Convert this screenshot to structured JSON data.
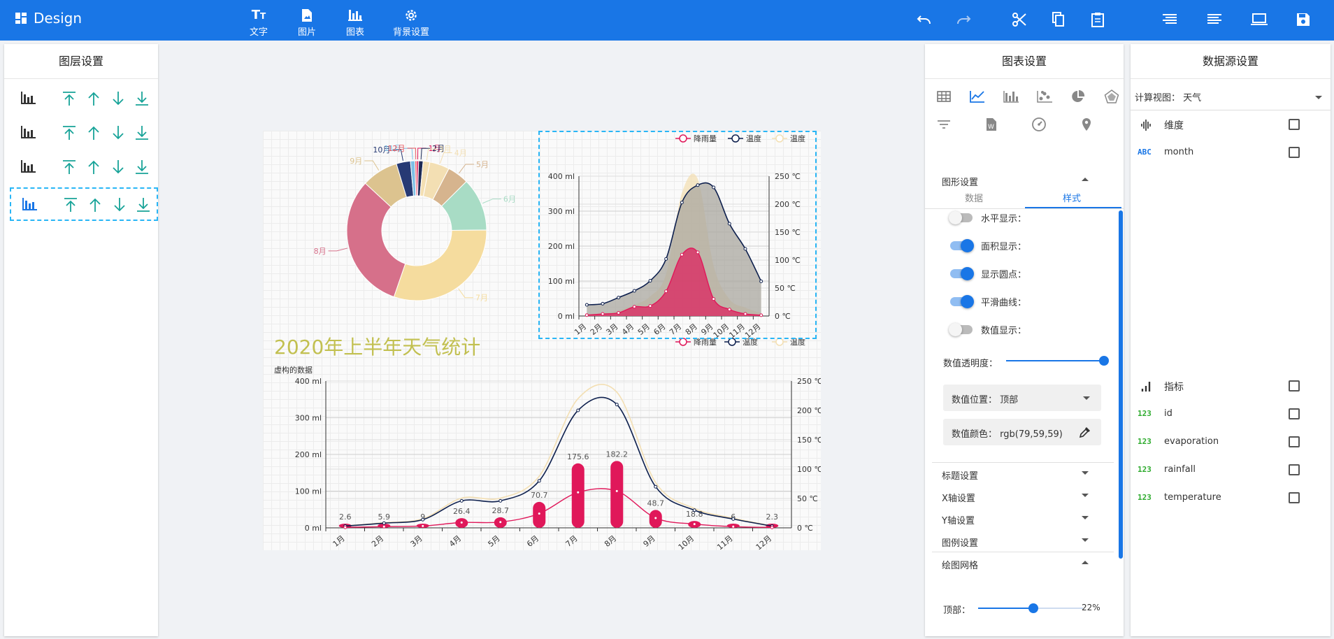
{
  "app": {
    "title": "Design"
  },
  "toolbar": {
    "items": [
      {
        "label": "文字",
        "icon": "text-icon"
      },
      {
        "label": "图片",
        "icon": "image-icon"
      },
      {
        "label": "图表",
        "icon": "chart-icon"
      },
      {
        "label": "背景设置",
        "icon": "gear-icon"
      }
    ]
  },
  "layer_panel": {
    "title": "图层设置"
  },
  "chart_settings": {
    "title": "图表设置",
    "tabs": [
      "数据",
      "样式"
    ],
    "active_tab": "样式",
    "sections": {
      "shape": "图形设置",
      "title": "标题设置",
      "xaxis": "X轴设置",
      "yaxis": "Y轴设置",
      "legend": "图例设置",
      "grid": "绘图网格"
    },
    "switches": [
      {
        "label": "水平显示：",
        "on": false
      },
      {
        "label": "面积显示：",
        "on": true
      },
      {
        "label": "显示圆点：",
        "on": true
      },
      {
        "label": "平滑曲线：",
        "on": true
      },
      {
        "label": "数值显示：",
        "on": false
      }
    ],
    "opacity_label": "数值透明度：",
    "opacity_value": 1.0,
    "value_position_label": "数值位置：",
    "value_position": "顶部",
    "value_color_label": "数值颜色：",
    "value_color": "rgb(79,59,59)",
    "top_label": "顶部：",
    "top_value": "22%",
    "top_fraction": 0.22
  },
  "data_source": {
    "title": "数据源设置",
    "view_label": "计算视图：",
    "view_value": "天气",
    "dimension_label": "维度",
    "dimensions": [
      {
        "badge": "ABC",
        "name": "month"
      }
    ],
    "measure_label": "指标",
    "measures": [
      {
        "badge": "123",
        "name": "id"
      },
      {
        "badge": "123",
        "name": "evaporation"
      },
      {
        "badge": "123",
        "name": "rainfall"
      },
      {
        "badge": "123",
        "name": "temperature"
      }
    ]
  },
  "colors": {
    "primary": "#1976e6",
    "rain": "#e0185a",
    "temp": "#0d1f4d",
    "temp2": "#f3dfb3",
    "title_green": "#c2c050",
    "selection": "#29b6f6"
  },
  "canvas": {
    "title": "2020年上半年天气统计"
  },
  "chart_data": [
    {
      "type": "pie",
      "variant": "donut",
      "categories": [
        "1月",
        "2月",
        "3月",
        "4月",
        "5月",
        "6月",
        "7月",
        "8月",
        "9月",
        "10月",
        "11月",
        "12月"
      ],
      "values": [
        2.6,
        5.9,
        9.0,
        26.4,
        28.7,
        70.7,
        175.6,
        182.2,
        48.7,
        18.8,
        6.0,
        2.3
      ],
      "colors": [
        "#e0185a",
        "#1c2a55",
        "#f3dfb3",
        "#f3dfb3",
        "#d6b48e",
        "#a8dcc5",
        "#f5dc9e",
        "#d6708a",
        "#dcc38f",
        "#273a74",
        "#7ec0e6",
        "#e9545b"
      ]
    },
    {
      "type": "area",
      "categories": [
        "1月",
        "2月",
        "3月",
        "4月",
        "5月",
        "6月",
        "7月",
        "8月",
        "9月",
        "10月",
        "11月",
        "12月"
      ],
      "series": [
        {
          "name": "降雨量",
          "values": [
            2.6,
            5.9,
            9.0,
            26.4,
            28.7,
            70.7,
            175.6,
            182.2,
            48.7,
            18.8,
            6.0,
            2.3
          ],
          "axis": "left"
        },
        {
          "name": "温度",
          "values": [
            2.0,
            2.2,
            3.3,
            4.5,
            6.3,
            10.2,
            20.3,
            23.4,
            23.0,
            16.5,
            12.0,
            6.2
          ],
          "axis": "right",
          "scale": 0.1
        },
        {
          "name": "温度",
          "values": [
            3,
            5,
            10,
            20,
            35,
            75,
            220,
            245,
            90,
            30,
            15,
            5
          ],
          "axis": "right"
        }
      ],
      "y_left": {
        "ticks": [
          "0 ml",
          "100 ml",
          "200 ml",
          "300 ml",
          "400 ml"
        ],
        "range": [
          0,
          400
        ]
      },
      "y_right": {
        "ticks": [
          "0 ℃",
          "50 ℃",
          "100 ℃",
          "150 ℃",
          "200 ℃",
          "250 ℃"
        ],
        "range": [
          0,
          250
        ]
      }
    },
    {
      "type": "bar",
      "subtitle": "虚构的数据",
      "categories": [
        "1月",
        "2月",
        "3月",
        "4月",
        "5月",
        "6月",
        "7月",
        "8月",
        "9月",
        "10月",
        "11月",
        "12月"
      ],
      "series": [
        {
          "name": "降雨量",
          "values": [
            2.6,
            5.9,
            9.0,
            26.4,
            28.7,
            70.7,
            175.6,
            182.2,
            48.7,
            18.8,
            6.0,
            2.3
          ]
        },
        {
          "name": "温度",
          "values": [
            3,
            8,
            14,
            46,
            46,
            80,
            200,
            210,
            70,
            30,
            15,
            3
          ]
        },
        {
          "name": "温度",
          "values": [
            2.6,
            5.9,
            9.0,
            26.4,
            28.7,
            70.7,
            175.6,
            182.2,
            48.7,
            18.8,
            6.0,
            2.3
          ]
        }
      ],
      "bar_labels": [
        "2.6",
        "5.9",
        "9",
        "26.4",
        "28.7",
        "70.7",
        "175.6",
        "182.2",
        "48.7",
        "18.8",
        "6",
        "2.3"
      ],
      "y_left": {
        "ticks": [
          "0 ml",
          "100 ml",
          "200 ml",
          "300 ml",
          "400 ml"
        ],
        "range": [
          0,
          400
        ]
      },
      "y_right": {
        "ticks": [
          "0 ℃",
          "50 ℃",
          "100 ℃",
          "150 ℃",
          "200 ℃",
          "250 ℃"
        ],
        "range": [
          0,
          250
        ]
      },
      "legend": [
        "降雨量",
        "温度",
        "温度"
      ]
    }
  ]
}
